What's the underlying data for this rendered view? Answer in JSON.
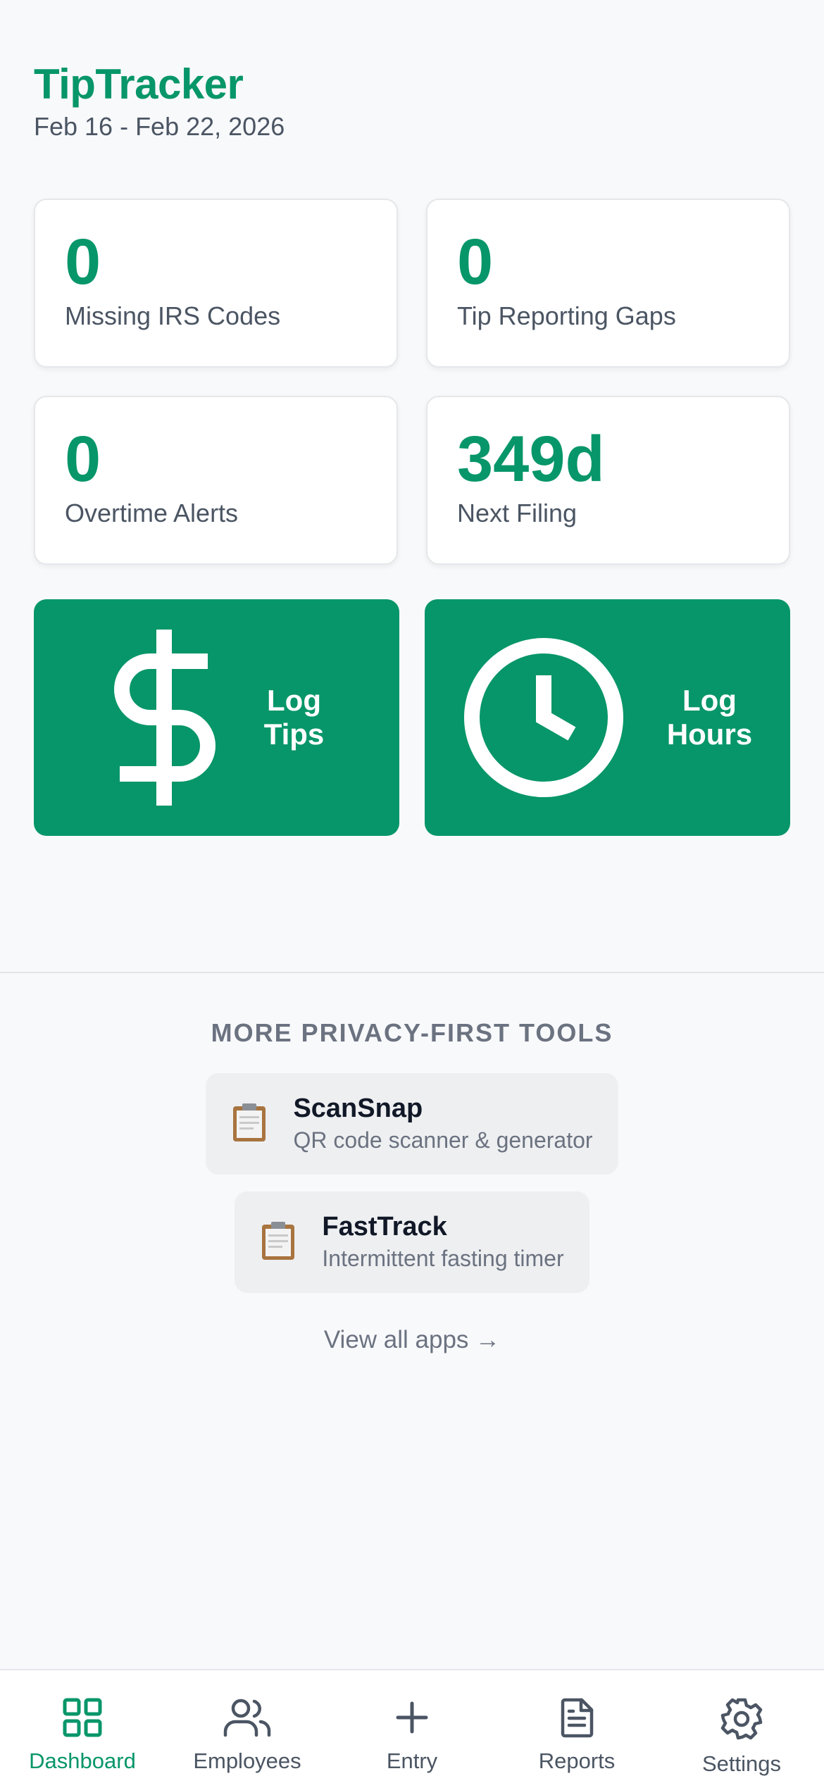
{
  "header": {
    "title": "TipTracker",
    "date_range": "Feb 16 - Feb 22, 2026"
  },
  "stats": [
    {
      "value": "0",
      "label": "Missing IRS Codes"
    },
    {
      "value": "0",
      "label": "Tip Reporting Gaps"
    },
    {
      "value": "0",
      "label": "Overtime Alerts"
    },
    {
      "value": "349d",
      "label": "Next Filing"
    }
  ],
  "actions": {
    "log_tips": {
      "label": "Log\nTips",
      "icon": "dollar-icon"
    },
    "log_hours": {
      "label": "Log\nHours",
      "icon": "clock-icon"
    }
  },
  "tools": {
    "heading": "MORE PRIVACY-FIRST TOOLS",
    "items": [
      {
        "name": "ScanSnap",
        "description": "QR code scanner & generator",
        "icon": "clipboard-icon"
      },
      {
        "name": "FastTrack",
        "description": "Intermittent fasting timer",
        "icon": "clipboard-icon"
      }
    ],
    "view_all": "View all apps →"
  },
  "tabbar": {
    "active": "Dashboard",
    "items": [
      {
        "label": "Dashboard",
        "icon": "grid-icon"
      },
      {
        "label": "Employees",
        "icon": "users-icon"
      },
      {
        "label": "Entry",
        "icon": "plus-icon"
      },
      {
        "label": "Reports",
        "icon": "document-icon"
      },
      {
        "label": "Settings",
        "icon": "gear-icon"
      }
    ]
  },
  "colors": {
    "accent": "#079669",
    "background": "#f8f9fb",
    "card": "#ffffff",
    "muted_text": "#6b7280"
  }
}
